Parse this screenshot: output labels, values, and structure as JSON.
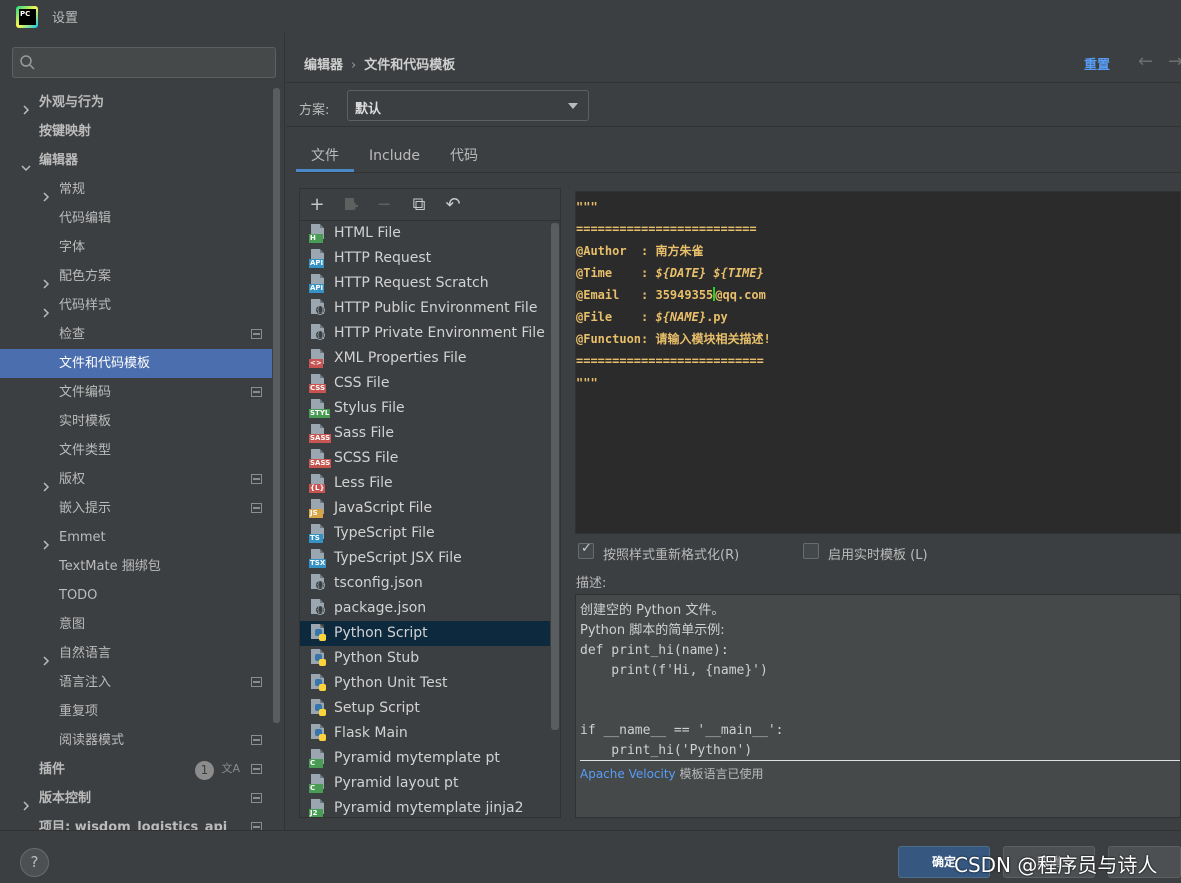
{
  "window": {
    "title": "设置"
  },
  "search": {
    "placeholder": ""
  },
  "sidebar": {
    "items": [
      {
        "label": "外观与行为",
        "arrow": "right",
        "indent": 0,
        "bold": true
      },
      {
        "label": "按键映射",
        "arrow": "",
        "indent": 0,
        "bold": true
      },
      {
        "label": "编辑器",
        "arrow": "down",
        "indent": 0,
        "bold": true
      },
      {
        "label": "常规",
        "arrow": "right",
        "indent": 1
      },
      {
        "label": "代码编辑",
        "arrow": "",
        "indent": 1
      },
      {
        "label": "字体",
        "arrow": "",
        "indent": 1
      },
      {
        "label": "配色方案",
        "arrow": "right",
        "indent": 1
      },
      {
        "label": "代码样式",
        "arrow": "right",
        "indent": 1
      },
      {
        "label": "检查",
        "arrow": "",
        "indent": 1,
        "project_icon": true
      },
      {
        "label": "文件和代码模板",
        "arrow": "",
        "indent": 1,
        "selected": true
      },
      {
        "label": "文件编码",
        "arrow": "",
        "indent": 1,
        "project_icon": true
      },
      {
        "label": "实时模板",
        "arrow": "",
        "indent": 1
      },
      {
        "label": "文件类型",
        "arrow": "",
        "indent": 1
      },
      {
        "label": "版权",
        "arrow": "right",
        "indent": 1,
        "project_icon": true
      },
      {
        "label": "嵌入提示",
        "arrow": "",
        "indent": 1,
        "project_icon": true
      },
      {
        "label": "Emmet",
        "arrow": "right",
        "indent": 1
      },
      {
        "label": "TextMate 捆绑包",
        "arrow": "",
        "indent": 1
      },
      {
        "label": "TODO",
        "arrow": "",
        "indent": 1
      },
      {
        "label": "意图",
        "arrow": "",
        "indent": 1
      },
      {
        "label": "自然语言",
        "arrow": "right",
        "indent": 1
      },
      {
        "label": "语言注入",
        "arrow": "",
        "indent": 1,
        "project_icon": true
      },
      {
        "label": "重复项",
        "arrow": "",
        "indent": 1
      },
      {
        "label": "阅读器模式",
        "arrow": "",
        "indent": 1,
        "project_icon": true
      },
      {
        "label": "插件",
        "arrow": "",
        "indent": 0,
        "bold": true,
        "count": "1",
        "translate_icon": true,
        "project_icon": true
      },
      {
        "label": "版本控制",
        "arrow": "right",
        "indent": 0,
        "bold": true,
        "project_icon": true
      },
      {
        "label": "项目: wisdom_logistics_api",
        "arrow": "right",
        "indent": 0,
        "bold": true,
        "project_icon": true
      }
    ]
  },
  "header": {
    "breadcrumb": [
      "编辑器",
      "文件和代码模板"
    ],
    "reset_label": "重置",
    "back_icon": "←",
    "forward_icon": "→"
  },
  "scheme": {
    "label": "方案:",
    "value": "默认"
  },
  "tabs": [
    {
      "label": "文件",
      "active": true
    },
    {
      "label": "Include",
      "active": false
    },
    {
      "label": "代码",
      "active": false
    }
  ],
  "toolbar": {
    "add": "+",
    "remove": "−",
    "copy": "⧉",
    "revert": "↶"
  },
  "files": [
    {
      "name": "HTML File",
      "tag": "H",
      "tag_color": "#499c54",
      "kind": "tag"
    },
    {
      "name": "HTTP Request",
      "tag": "API",
      "tag_color": "#3592c4",
      "kind": "tag"
    },
    {
      "name": "HTTP Request Scratch",
      "tag": "API",
      "tag_color": "#3592c4",
      "kind": "tag"
    },
    {
      "name": "HTTP Public Environment File",
      "kind": "brace"
    },
    {
      "name": "HTTP Private Environment File",
      "kind": "brace"
    },
    {
      "name": "XML Properties File",
      "tag": "<>",
      "tag_color": "#c75450",
      "kind": "tag"
    },
    {
      "name": "CSS File",
      "tag": "CSS",
      "tag_color": "#c75450",
      "kind": "tag"
    },
    {
      "name": "Stylus File",
      "tag": "STYL",
      "tag_color": "#499c54",
      "kind": "tag"
    },
    {
      "name": "Sass File",
      "tag": "SASS",
      "tag_color": "#c75450",
      "kind": "tag"
    },
    {
      "name": "SCSS File",
      "tag": "SASS",
      "tag_color": "#c75450",
      "kind": "tag"
    },
    {
      "name": "Less File",
      "tag": "{L}",
      "tag_color": "#c75450",
      "kind": "tag"
    },
    {
      "name": "JavaScript File",
      "tag": "JS",
      "tag_color": "#d9a343",
      "kind": "tag"
    },
    {
      "name": "TypeScript File",
      "tag": "TS",
      "tag_color": "#3592c4",
      "kind": "tag"
    },
    {
      "name": "TypeScript JSX File",
      "tag": "TSX",
      "tag_color": "#3592c4",
      "kind": "tag"
    },
    {
      "name": "tsconfig.json",
      "kind": "brace"
    },
    {
      "name": "package.json",
      "kind": "brace"
    },
    {
      "name": "Python Script",
      "kind": "py",
      "selected": true
    },
    {
      "name": "Python Stub",
      "kind": "py"
    },
    {
      "name": "Python Unit Test",
      "kind": "py"
    },
    {
      "name": "Setup Script",
      "kind": "py"
    },
    {
      "name": "Flask Main",
      "kind": "py"
    },
    {
      "name": "Pyramid mytemplate pt",
      "tag": "C",
      "tag_color": "#499c54",
      "kind": "tag"
    },
    {
      "name": "Pyramid layout pt",
      "tag": "C",
      "tag_color": "#499c54",
      "kind": "tag"
    },
    {
      "name": "Pyramid mytemplate jinja2",
      "tag": "J2",
      "tag_color": "#499c54",
      "kind": "tag"
    }
  ],
  "editor": {
    "lines": [
      {
        "text": "\"\"\""
      },
      {
        "text": "========================="
      },
      {
        "text": "@Author  : 南方朱雀"
      },
      {
        "text": "@Time    : ",
        "italic_tail": "${DATE} ${TIME}"
      },
      {
        "text": "@Email   : 35949355",
        "caret": true,
        "after_caret": "@qq.com"
      },
      {
        "text": "@File    : ",
        "italic_tail": "${NAME}",
        "tail2": ".py"
      },
      {
        "text": "@Functuon: 请输入模块相关描述!"
      },
      {
        "text": "=========================="
      },
      {
        "text": "\"\"\""
      }
    ]
  },
  "options": {
    "reformat_label": "按照样式重新格式化(R)",
    "reformat_checked": true,
    "live_templates_label": "启用实时模板 (L)",
    "live_templates_checked": false
  },
  "description": {
    "label": "描述:",
    "lines": [
      {
        "text": "创建空的 Python 文件。",
        "prose": true
      },
      {
        "text": "Python 脚本的简单示例:",
        "prose": true
      },
      {
        "text": "def print_hi(name):"
      },
      {
        "text": "    print(f'Hi, {name}')"
      },
      {
        "text": ""
      },
      {
        "text": ""
      },
      {
        "text": "if __name__ == '__main__':"
      },
      {
        "text": "    print_hi('Python')"
      }
    ],
    "footer_link": "Apache Velocity",
    "footer_text": " 模板语言已使用"
  },
  "footer": {
    "help_label": "?",
    "ok_label": "确定",
    "cancel_label": "取消",
    "watermark": "CSDN @程序员与诗人"
  }
}
